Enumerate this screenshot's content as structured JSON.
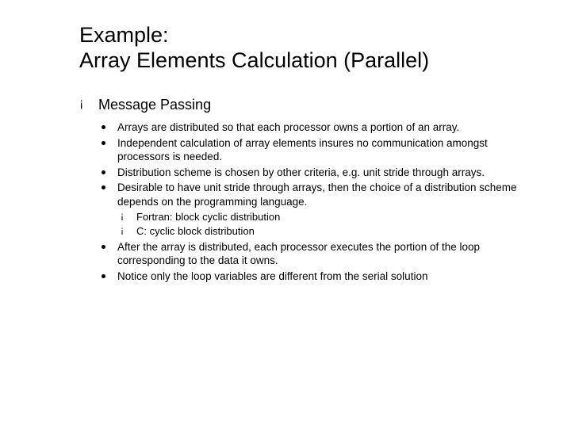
{
  "title": "Example:\nArray Elements Calculation (Parallel)",
  "bullets": {
    "b0": {
      "label": "Message Passing",
      "items": {
        "i0": "Arrays are distributed so that each processor owns a portion of an array.",
        "i1": "Independent calculation of array elements insures no communication amongst processors is needed.",
        "i2": "Distribution scheme is chosen by other criteria, e.g. unit stride through arrays.",
        "i3": {
          "text": "Desirable to have unit stride through arrays, then the choice of a distribution scheme depends on the programming language.",
          "sub": {
            "s0": "Fortran: block cyclic distribution",
            "s1": "C: cyclic block distribution"
          }
        },
        "i4": "After the array is distributed, each processor executes the portion of the loop corresponding to the data it owns.",
        "i5": "Notice only the loop variables are different from the serial solution"
      }
    }
  }
}
